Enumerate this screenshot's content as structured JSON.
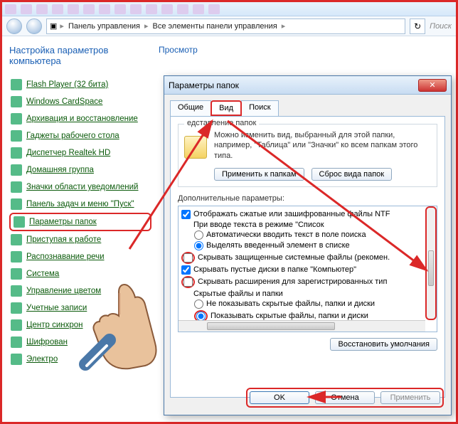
{
  "breadcrumb": {
    "root": "Панель управления",
    "sub": "Все элементы панели управления"
  },
  "search_hint": "Поиск",
  "main_heading": "Настройка параметров компьютера",
  "view_link": "Просмотр",
  "cp_items": [
    "Flash Player (32 бита)",
    "Windows CardSpace",
    "Архивация и восстановление",
    "Гаджеты рабочего стола",
    "Диспетчер Realtek HD",
    "Домашняя группа",
    "Значки области уведомлений",
    "Панель задач и меню \"Пуск\"",
    "Параметры папок",
    "Приступая к работе",
    "Распознавание речи",
    "Система",
    "Управление цветом",
    "Учетные записи",
    "Центр синхрон",
    "Шифрован",
    "Электро"
  ],
  "dialog": {
    "title": "Параметры папок",
    "tabs": [
      "Общие",
      "Вид",
      "Поиск"
    ],
    "folder_group": {
      "label": "едставление папок",
      "desc": "Можно изменить вид, выбранный для этой папки, например, \"Таблица\" или \"Значки\" ко всем папкам этого типа.",
      "apply_btn": "Применить к папкам",
      "reset_btn": "Сброс вида папок"
    },
    "adv_label": "Дополнительные параметры:",
    "adv": {
      "r0": "Отображать сжатые или зашифрованные файлы NTF",
      "r1": "При вводе текста в режиме \"Список",
      "r2": "Автоматически вводить текст в поле поиска",
      "r3": "Выделять введенный элемент в списке",
      "r4": "Скрывать защищенные системные файлы (рекомен.",
      "r5": "Скрывать пустые диски в папке \"Компьютер\"",
      "r6": "Скрывать расширения для зарегистрированных тип",
      "r7": "Скрытые файлы и папки",
      "r8": "Не показывать скрытые файлы, папки и диски",
      "r9": "Показывать скрытые файлы, папки и диски"
    },
    "restore_btn": "Восстановить умолчания",
    "ok": "OK",
    "cancel": "Отмена",
    "apply": "Применить"
  }
}
